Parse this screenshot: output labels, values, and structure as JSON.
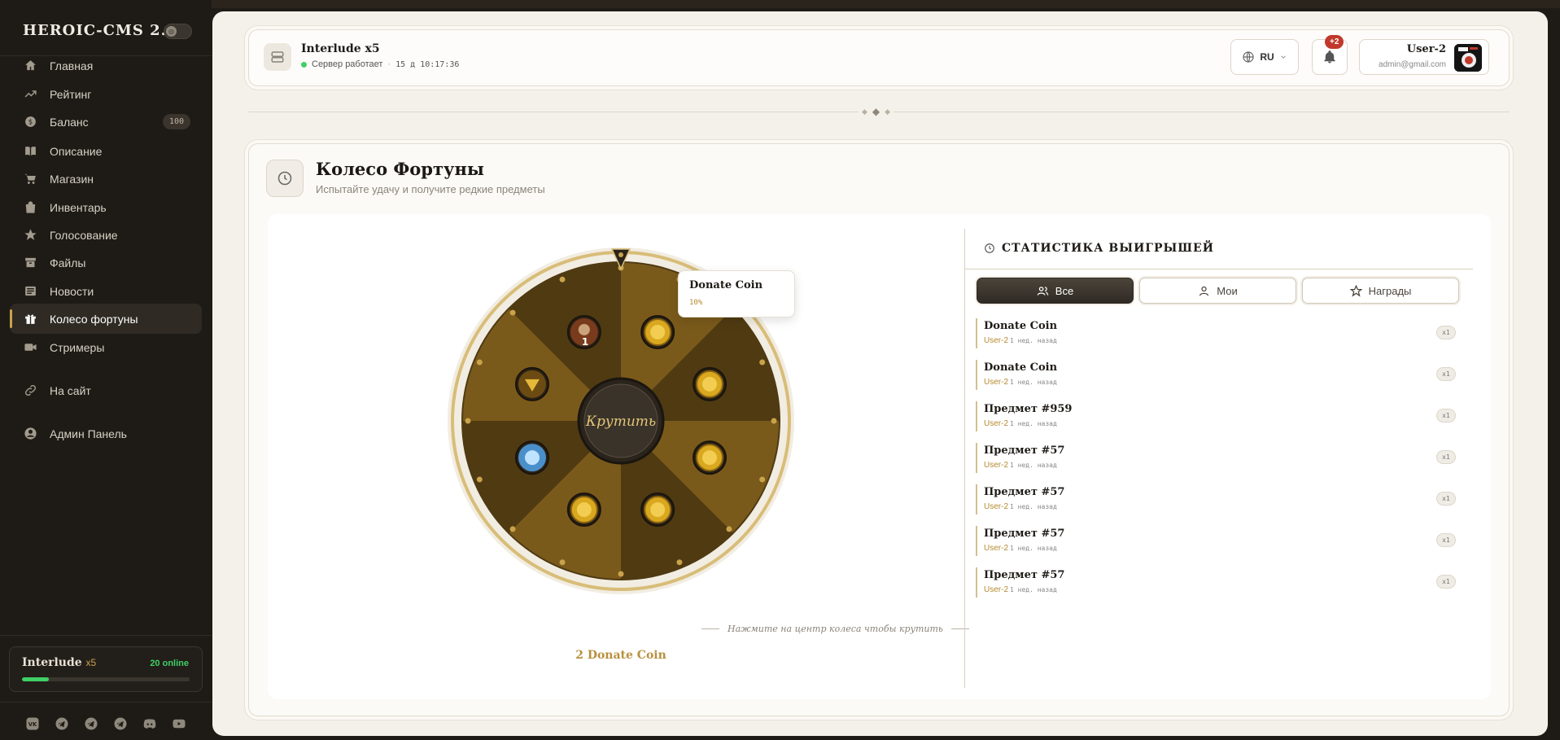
{
  "brand": {
    "title": "HEROIC-CMS 2.0",
    "toggle_glyph": "◎"
  },
  "nav": [
    {
      "label": "Главная",
      "icon": "home-icon"
    },
    {
      "label": "Рейтинг",
      "icon": "trend-icon"
    },
    {
      "label": "Баланс",
      "icon": "coin-icon",
      "badge": "100"
    },
    {
      "label": "Описание",
      "icon": "book-icon"
    },
    {
      "label": "Магазин",
      "icon": "cart-icon"
    },
    {
      "label": "Инвентарь",
      "icon": "bag-icon"
    },
    {
      "label": "Голосование",
      "icon": "star-icon"
    },
    {
      "label": "Файлы",
      "icon": "archive-icon"
    },
    {
      "label": "Новости",
      "icon": "news-icon"
    },
    {
      "label": "Колесо фортуны",
      "icon": "gift-icon",
      "active": true
    },
    {
      "label": "Стримеры",
      "icon": "video-icon"
    },
    {
      "label": "На сайт",
      "icon": "link-icon"
    },
    {
      "label": "Админ Панель",
      "icon": "admin-icon"
    }
  ],
  "server_card": {
    "name": "Interlude",
    "rate": "x5",
    "online": "20 online",
    "load_fraction": 0.16
  },
  "socials": [
    "vk-icon",
    "telegram-icon",
    "telegram-icon",
    "telegram-icon",
    "discord-icon",
    "youtube-icon"
  ],
  "header": {
    "server_name": "Interlude x5",
    "status": "Сервер работает",
    "uptime": "15 д 10:17:36",
    "lang": "RU",
    "notif_badge": "+2",
    "user_name": "User-2",
    "user_email": "admin@gmail.com"
  },
  "page": {
    "title": "Колесо Фортуны",
    "subtitle": "Испытайте удачу и получите редкие предметы"
  },
  "wheel": {
    "center_label": "Крутить",
    "hint": "Нажмите на центр колеса чтобы крутить",
    "cost": "2 Donate Coin",
    "colors": {
      "dark": "#4f3a12",
      "light": "#7a5a1b",
      "rim": "#d8bd78",
      "accent": "#c9a24a"
    },
    "segments": [
      {
        "item": "donate-coin-icon"
      },
      {
        "item": "donate-coin-icon"
      },
      {
        "item": "donate-coin-icon"
      },
      {
        "item": "donate-coin-icon"
      },
      {
        "item": "donate-coin-icon"
      },
      {
        "item": "blue-crystal-icon"
      },
      {
        "item": "golden-emblem-icon"
      },
      {
        "item": "warrior-item-icon",
        "qty": "1"
      }
    ]
  },
  "tooltip": {
    "name": "Donate Coin",
    "chance": "10%"
  },
  "stats": {
    "title": "СТАТИСТИКА ВЫИГРЫШЕЙ",
    "tabs": [
      "Все",
      "Мои",
      "Награды"
    ],
    "wins": [
      {
        "item": "Donate Coin",
        "user": "User-2",
        "time": "1 нед. назад",
        "qty": "x1"
      },
      {
        "item": "Donate Coin",
        "user": "User-2",
        "time": "1 нед. назад",
        "qty": "x1"
      },
      {
        "item": "Предмет #959",
        "user": "User-2",
        "time": "1 нед. назад",
        "qty": "x1"
      },
      {
        "item": "Предмет #57",
        "user": "User-2",
        "time": "1 нед. назад",
        "qty": "x1"
      },
      {
        "item": "Предмет #57",
        "user": "User-2",
        "time": "1 нед. назад",
        "qty": "x1"
      },
      {
        "item": "Предмет #57",
        "user": "User-2",
        "time": "1 нед. назад",
        "qty": "x1"
      },
      {
        "item": "Предмет #57",
        "user": "User-2",
        "time": "1 нед. назад",
        "qty": "x1"
      }
    ]
  }
}
